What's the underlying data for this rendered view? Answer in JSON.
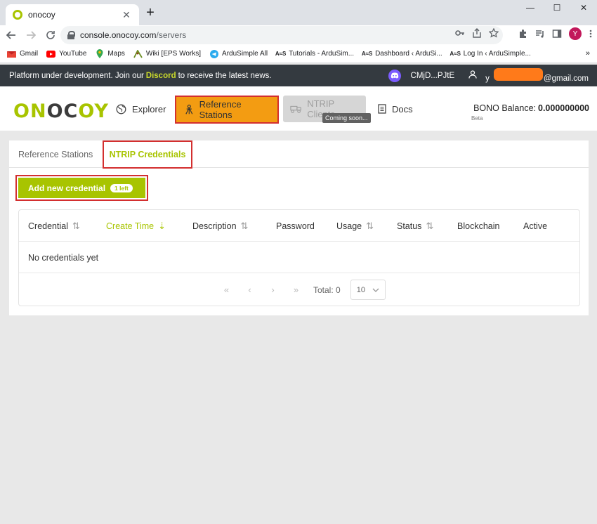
{
  "browser": {
    "tab_title": "onocoy",
    "tab_close": "✕",
    "new_tab": "+",
    "win_minimize": "—",
    "win_maximize": "☐",
    "win_close": "✕",
    "url_host": "console.onocoy.com",
    "url_path": "/servers",
    "profile_initial": "Y",
    "bookmarks": [
      {
        "label": "Gmail",
        "icon": "gmail-icon"
      },
      {
        "label": "YouTube",
        "icon": "youtube-icon"
      },
      {
        "label": "Maps",
        "icon": "maps-icon"
      },
      {
        "label": "Wiki [EPS Works]",
        "icon": "wiki-icon"
      },
      {
        "label": "ArduSimple All",
        "icon": "telegram-icon"
      },
      {
        "label": "Tutorials - ArduSim...",
        "icon": "ardusimple-icon"
      },
      {
        "label": "Dashboard ‹ ArduSi...",
        "icon": "ardusimple-icon"
      },
      {
        "label": "Log In ‹ ArduSimple...",
        "icon": "ardusimple-icon"
      }
    ],
    "bookmarks_more": "»"
  },
  "banner": {
    "text_before": "Platform under development. Join our",
    "discord": "Discord",
    "text_after": "to receive the latest news.",
    "discord_user": "CMjD...PJtE",
    "email_prefix": "y",
    "email_suffix": "@gmail.com"
  },
  "nav": {
    "logo_a": "ON",
    "logo_b": "OC",
    "logo_c": "OY",
    "explorer": "Explorer",
    "reference_stations": "Reference Stations",
    "ntrip_clients": "NTRIP Clients",
    "coming_soon": "Coming soon...",
    "docs": "Docs",
    "balance_label": "BONO Balance:",
    "balance_value": "0.000000000",
    "beta": "Beta"
  },
  "subtabs": {
    "reference_stations": "Reference Stations",
    "ntrip_credentials": "NTRIP Credentials"
  },
  "add_button": {
    "label": "Add new credential",
    "badge": "1 left"
  },
  "table": {
    "columns": [
      {
        "label": "Credential",
        "sortable": true
      },
      {
        "label": "Create Time",
        "sortable": true,
        "active": true
      },
      {
        "label": "Description",
        "sortable": true
      },
      {
        "label": "Password",
        "sortable": false
      },
      {
        "label": "Usage",
        "sortable": true
      },
      {
        "label": "Status",
        "sortable": true
      },
      {
        "label": "Blockchain",
        "sortable": false
      },
      {
        "label": "Active",
        "sortable": false
      }
    ],
    "empty_text": "No credentials yet",
    "pager": {
      "first": "«",
      "prev": "‹",
      "next": "›",
      "last": "»",
      "total": "Total: 0",
      "page_size": "10"
    }
  },
  "colors": {
    "brand": "#a8c400",
    "highlight_orange": "#f39c12",
    "annotation_red": "#d32f2f",
    "banner_bg": "#343a40"
  }
}
